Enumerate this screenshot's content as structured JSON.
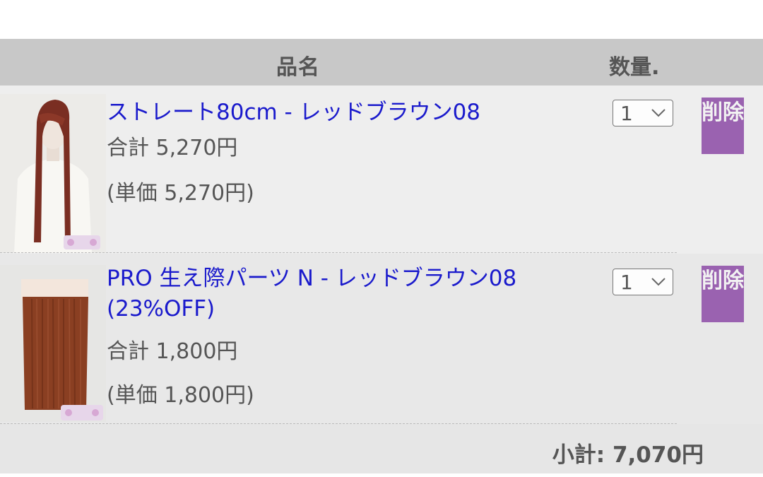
{
  "header": {
    "col_name": "品名",
    "col_qty": "数量."
  },
  "items": [
    {
      "name": "ストレート80cm - レッドブラウン08",
      "total": "合計 5,270円",
      "unit": "(単価 5,270円)",
      "quantity": "1",
      "delete_label": "削除"
    },
    {
      "name": "PRO 生え際パーツ N - レッドブラウン08 (23%OFF)",
      "total": "合計 1,800円",
      "unit": "(単価 1,800円)",
      "quantity": "1",
      "delete_label": "削除"
    }
  ],
  "subtotal": "小計: 7,070円",
  "colors": {
    "link": "#1a1acc",
    "delete": "#9a62b0",
    "header_bg": "#c8c8c8"
  }
}
